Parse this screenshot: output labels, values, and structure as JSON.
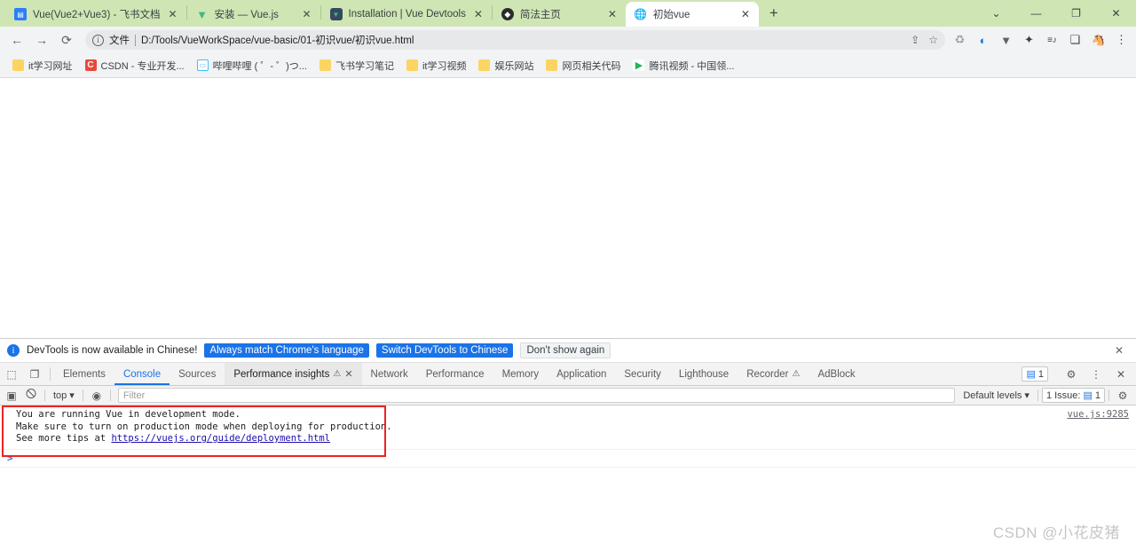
{
  "browser": {
    "tabs": [
      {
        "title": "Vue(Vue2+Vue3) - 飞书文档",
        "icon": "feishu-doc-icon",
        "active": false
      },
      {
        "title": "安装 — Vue.js",
        "icon": "vue-logo-icon",
        "active": false
      },
      {
        "title": "Installation | Vue Devtools",
        "icon": "vue-devtools-icon",
        "active": false
      },
      {
        "title": "简法主页",
        "icon": "jianfa-icon",
        "active": false
      },
      {
        "title": "初始vue",
        "icon": "globe-icon",
        "active": true
      }
    ],
    "new_tab_label": "+",
    "window_controls": {
      "tab_search": "⌄",
      "minimize": "—",
      "maximize": "❐",
      "close": "✕"
    },
    "toolbar": {
      "back": "←",
      "forward": "→",
      "reload": "⟳",
      "share": "share-icon",
      "bookmark": "☆",
      "menu": "⋮"
    },
    "omnibox": {
      "scheme_label": "文件",
      "url": "D:/Tools/VueWorkSpace/vue-basic/01-初识vue/初识vue.html",
      "info_glyph": "ⓘ"
    },
    "extensions": [
      {
        "name": "recycle-extension-icon",
        "glyph": "♻"
      },
      {
        "name": "opera-extension-icon",
        "glyph": "◐"
      },
      {
        "name": "vue-devtools-extension-icon",
        "glyph": "▼"
      },
      {
        "name": "puzzle-extensions-icon",
        "glyph": "✦"
      },
      {
        "name": "reading-list-icon",
        "glyph": "≡♪"
      },
      {
        "name": "side-panel-icon",
        "glyph": "❏"
      },
      {
        "name": "profile-avatar-icon",
        "glyph": "🐴"
      }
    ],
    "bookmarks": [
      {
        "label": "it学习网址",
        "icon": "folder-icon",
        "icon_class": "ic-folder",
        "glyph": ""
      },
      {
        "label": "CSDN - 专业开发...",
        "icon": "csdn-icon",
        "icon_class": "ic-csdn",
        "glyph": "C"
      },
      {
        "label": "哔哩哔哩 ( ゜- ゜)つ...",
        "icon": "bilibili-icon",
        "icon_class": "ic-bili",
        "glyph": "tv"
      },
      {
        "label": "飞书学习笔记",
        "icon": "folder-icon",
        "icon_class": "ic-folder",
        "glyph": ""
      },
      {
        "label": "it学习视频",
        "icon": "folder-icon",
        "icon_class": "ic-folder",
        "glyph": ""
      },
      {
        "label": "娱乐网站",
        "icon": "folder-icon",
        "icon_class": "ic-folder",
        "glyph": ""
      },
      {
        "label": "网页相关代码",
        "icon": "folder-icon",
        "icon_class": "ic-folder",
        "glyph": ""
      },
      {
        "label": "腾讯视频 - 中国领...",
        "icon": "tencent-video-icon",
        "icon_class": "ic-tx",
        "glyph": "▶"
      }
    ]
  },
  "devtools": {
    "notice": {
      "text": "DevTools is now available in Chinese!",
      "primary_button": "Always match Chrome's language",
      "secondary_button": "Switch DevTools to Chinese",
      "dismiss_button": "Don't show again",
      "close": "✕"
    },
    "panel_tabs": [
      {
        "label": "Elements",
        "state": "normal"
      },
      {
        "label": "Console",
        "state": "selected"
      },
      {
        "label": "Sources",
        "state": "normal"
      },
      {
        "label": "Performance insights",
        "state": "panel-open",
        "warn": "⚠",
        "closeable": "✕"
      },
      {
        "label": "Network",
        "state": "normal"
      },
      {
        "label": "Performance",
        "state": "normal"
      },
      {
        "label": "Memory",
        "state": "normal"
      },
      {
        "label": "Application",
        "state": "normal"
      },
      {
        "label": "Security",
        "state": "normal"
      },
      {
        "label": "Lighthouse",
        "state": "normal"
      },
      {
        "label": "Recorder",
        "state": "normal",
        "warn": "⚠"
      },
      {
        "label": "AdBlock",
        "state": "normal"
      }
    ],
    "tabbar_right": {
      "message_count": "1",
      "settings": "⚙",
      "more": "⋮",
      "close": "✕"
    },
    "console_toolbar": {
      "sidebar_toggle": "▣",
      "clear": "🚫",
      "context": "top",
      "context_caret": "▾",
      "eye": "👁",
      "filter_placeholder": "Filter",
      "levels": "Default levels",
      "levels_caret": "▾",
      "issues": "1 Issue:",
      "issues_count": "1",
      "settings": "⚙"
    },
    "console_messages": [
      {
        "line1": "You are running Vue in development mode.",
        "line2": "Make sure to turn on production mode when deploying for production.",
        "line3_prefix": "See more tips at ",
        "line3_link": "https://vuejs.org/guide/deployment.html",
        "source": "vue.js:9285"
      }
    ],
    "prompt_caret": ">"
  },
  "watermark": "CSDN @小花皮猪",
  "colors": {
    "tabstrip_bg": "#cfe6b4",
    "accent_blue": "#1a73e8",
    "annotation_red": "#ee2222",
    "toolbar_bg": "#f1f3f4"
  }
}
